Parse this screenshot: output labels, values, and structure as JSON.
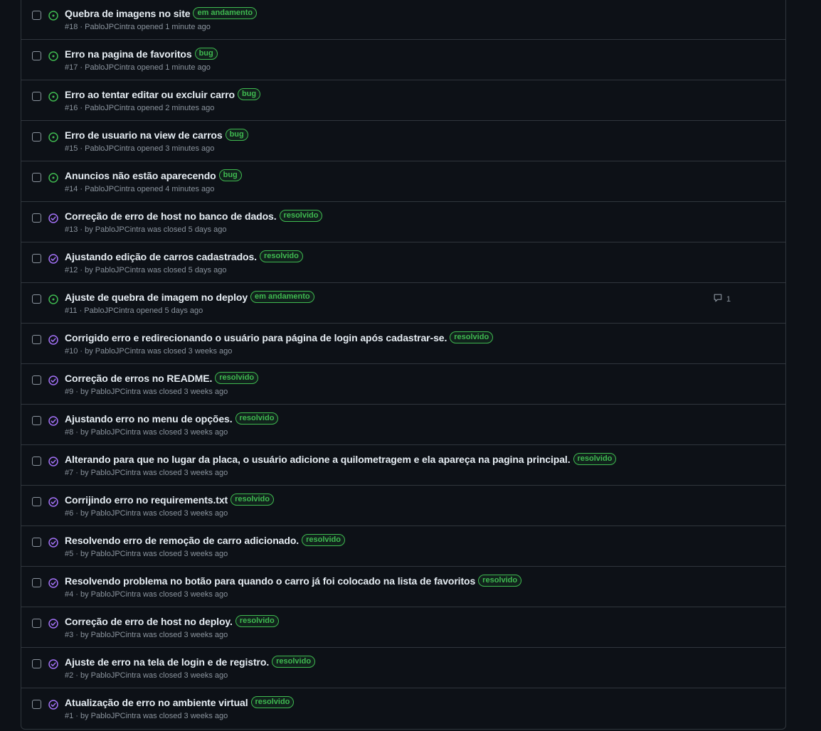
{
  "colors": {
    "open": "#3fb950",
    "closed": "#a371f7",
    "label": "#3fb950"
  },
  "issues": [
    {
      "state": "open",
      "title": "Quebra de imagens no site",
      "label": "em andamento",
      "meta": "#18 · PabloJPCintra opened 1 minute ago"
    },
    {
      "state": "open",
      "title": "Erro na pagina de favoritos",
      "label": "bug",
      "meta": "#17 · PabloJPCintra opened 1 minute ago"
    },
    {
      "state": "open",
      "title": "Erro ao tentar editar ou excluir carro",
      "label": "bug",
      "meta": "#16 · PabloJPCintra opened 2 minutes ago"
    },
    {
      "state": "open",
      "title": "Erro de usuario na view de carros",
      "label": "bug",
      "meta": "#15 · PabloJPCintra opened 3 minutes ago"
    },
    {
      "state": "open",
      "title": "Anuncios não estão aparecendo",
      "label": "bug",
      "meta": "#14 · PabloJPCintra opened 4 minutes ago"
    },
    {
      "state": "closed",
      "title": "Correção de erro de host no banco de dados.",
      "label": "resolvido",
      "meta": "#13 · by PabloJPCintra was closed 5 days ago"
    },
    {
      "state": "closed",
      "title": "Ajustando edição de carros cadastrados.",
      "label": "resolvido",
      "meta": "#12 · by PabloJPCintra was closed 5 days ago"
    },
    {
      "state": "open",
      "title": "Ajuste de quebra de imagem no deploy",
      "label": "em andamento",
      "meta": "#11 · PabloJPCintra opened 5 days ago",
      "comments": "1"
    },
    {
      "state": "closed",
      "title": "Corrigido erro e redirecionando o usuário para página de login após cadastrar-se.",
      "label": "resolvido",
      "meta": "#10 · by PabloJPCintra was closed 3 weeks ago"
    },
    {
      "state": "closed",
      "title": "Correção de erros no README.",
      "label": "resolvido",
      "meta": "#9 · by PabloJPCintra was closed 3 weeks ago"
    },
    {
      "state": "closed",
      "title": "Ajustando erro no menu de opções.",
      "label": "resolvido",
      "meta": "#8 · by PabloJPCintra was closed 3 weeks ago"
    },
    {
      "state": "closed",
      "title": "Alterando para que no lugar da placa, o usuário adicione a quilometragem e ela apareça na pagina principal.",
      "label": "resolvido",
      "meta": "#7 · by PabloJPCintra was closed 3 weeks ago"
    },
    {
      "state": "closed",
      "title": "Corrijindo erro no requirements.txt",
      "label": "resolvido",
      "meta": "#6 · by PabloJPCintra was closed 3 weeks ago"
    },
    {
      "state": "closed",
      "title": "Resolvendo erro de remoção de carro adicionado.",
      "label": "resolvido",
      "meta": "#5 · by PabloJPCintra was closed 3 weeks ago"
    },
    {
      "state": "closed",
      "title": "Resolvendo problema no botão para quando o carro já foi colocado na lista de favoritos",
      "label": "resolvido",
      "meta": "#4 · by PabloJPCintra was closed 3 weeks ago"
    },
    {
      "state": "closed",
      "title": "Correção de erro de host no deploy.",
      "label": "resolvido",
      "meta": "#3 · by PabloJPCintra was closed 3 weeks ago"
    },
    {
      "state": "closed",
      "title": "Ajuste de erro na tela de login e de registro.",
      "label": "resolvido",
      "meta": "#2 · by PabloJPCintra was closed 3 weeks ago"
    },
    {
      "state": "closed",
      "title": "Atualização de erro no ambiente virtual",
      "label": "resolvido",
      "meta": "#1 · by PabloJPCintra was closed 3 weeks ago"
    }
  ]
}
